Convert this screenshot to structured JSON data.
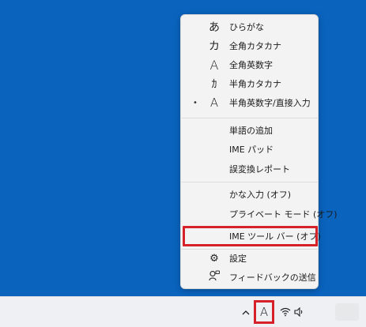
{
  "menu": {
    "items": [
      {
        "glyph": "あ",
        "label": "ひらがな",
        "bullet": ""
      },
      {
        "glyph": "カ",
        "label": "全角カタカナ",
        "bullet": ""
      },
      {
        "glyph": "A",
        "label": "全角英数字",
        "bullet": ""
      },
      {
        "glyph": "ｶ",
        "label": "半角カタカナ",
        "bullet": ""
      },
      {
        "glyph": "A",
        "label": "半角英数字/直接入力",
        "bullet": "•"
      },
      {
        "glyph": "",
        "label": "単語の追加",
        "bullet": ""
      },
      {
        "glyph": "",
        "label": "IME パッド",
        "bullet": ""
      },
      {
        "glyph": "",
        "label": "誤変換レポート",
        "bullet": ""
      },
      {
        "glyph": "",
        "label": "かな入力 (オフ)",
        "bullet": ""
      },
      {
        "glyph": "",
        "label": "プライベート モード (オフ)",
        "bullet": ""
      },
      {
        "glyph": "",
        "label": "IME ツール バー (オフ)",
        "bullet": ""
      },
      {
        "glyph": "⚙",
        "label": "設定",
        "bullet": ""
      },
      {
        "glyph": "",
        "label": "フィードバックの送信",
        "bullet": ""
      }
    ]
  },
  "taskbar": {
    "ime_indicator": "A",
    "chevron_icon": "chevron-up-icon",
    "wifi_icon": "wifi-icon",
    "volume_icon": "volume-icon"
  },
  "colors": {
    "desktop": "#0a63bd",
    "highlight": "#d6202a",
    "menu_bg": "#f3f3f3"
  }
}
